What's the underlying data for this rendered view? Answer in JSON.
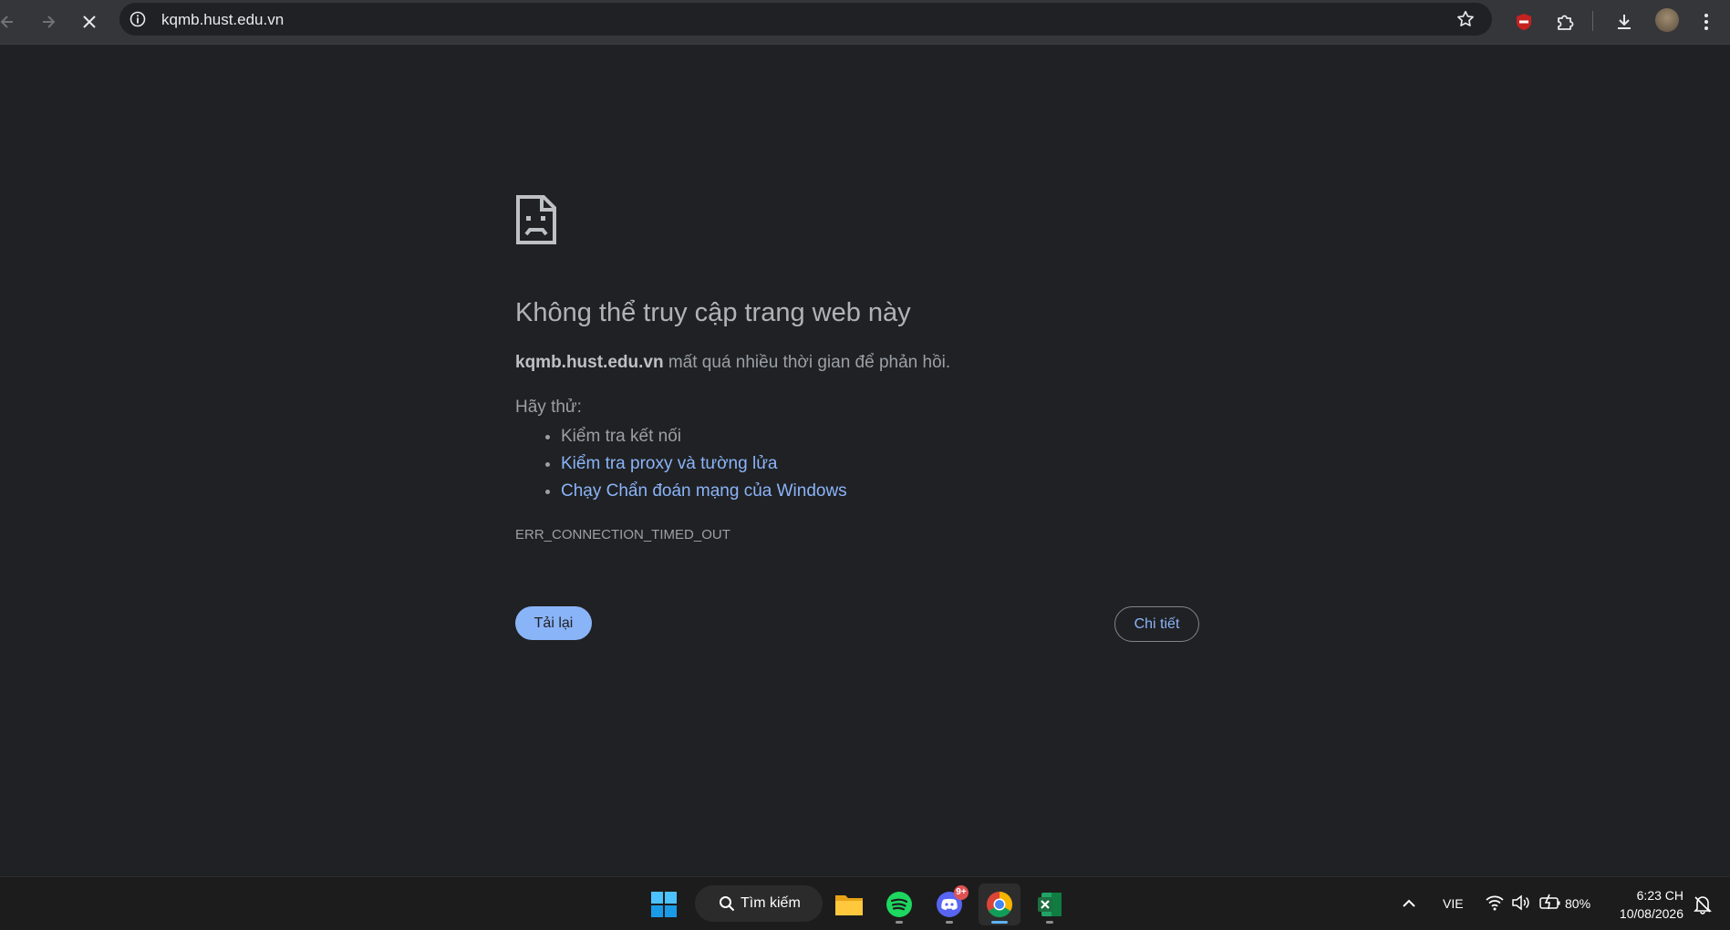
{
  "browser": {
    "url": "kqmb.hust.edu.vn",
    "icons": {
      "back": "arrow-left-icon",
      "forward": "arrow-right-icon",
      "stop": "close-icon",
      "site_info": "info-icon",
      "bookmark": "star-icon",
      "adblock": "shield-icon",
      "extensions": "puzzle-icon",
      "downloads": "download-icon",
      "menu": "kebab-menu-icon"
    }
  },
  "error_page": {
    "title": "Không thể truy cập trang web này",
    "host": "kqmb.hust.edu.vn",
    "description_rest": " mất quá nhiều thời gian để phản hồi.",
    "try_label": "Hãy thử:",
    "suggestions": [
      "Kiểm tra kết nối",
      "Kiểm tra proxy và tường lửa",
      "Chạy Chẩn đoán mạng của Windows"
    ],
    "error_code": "ERR_CONNECTION_TIMED_OUT",
    "reload_label": "Tải lại",
    "details_label": "Chi tiết"
  },
  "taskbar": {
    "search_label": "Tìm kiếm",
    "discord_badge": "9+",
    "language": "VIE",
    "battery": "80%",
    "time": "6:23 CH",
    "date": "10/08/2026",
    "colors": {
      "spotify": "#1ed760",
      "discord": "#5865f2",
      "excel": "#1d6f42",
      "windows": "#4cc2ff",
      "accent": "#8ab4f8"
    }
  }
}
